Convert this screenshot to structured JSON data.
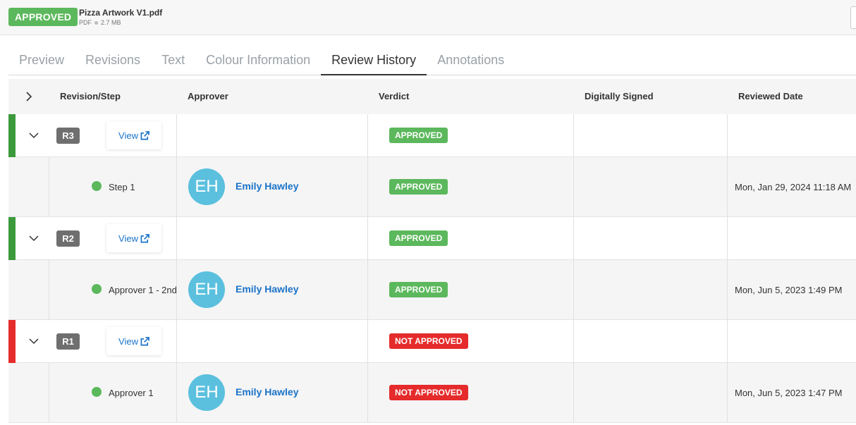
{
  "header": {
    "status": "APPROVED",
    "file_name": "Pizza Artwork V1.pdf",
    "file_type": "PDF",
    "file_size": "2.7 MB"
  },
  "tabs": [
    {
      "label": "Preview"
    },
    {
      "label": "Revisions"
    },
    {
      "label": "Text"
    },
    {
      "label": "Colour Information"
    },
    {
      "label": "Review History"
    },
    {
      "label": "Annotations"
    }
  ],
  "table": {
    "columns": {
      "revision_step": "Revision/Step",
      "approver": "Approver",
      "verdict": "Verdict",
      "digitally_signed": "Digitally Signed",
      "reviewed_date": "Reviewed Date"
    },
    "view_label": "View",
    "revisions": [
      {
        "badge": "R3",
        "verdict": "APPROVED",
        "accent_color": "#3c9a3c",
        "step": {
          "label": "Step 1",
          "avatar": "EH",
          "name": "Emily Hawley",
          "verdict": "APPROVED",
          "date": "Mon, Jan 29, 2024 11:18 AM"
        }
      },
      {
        "badge": "R2",
        "verdict": "APPROVED",
        "accent_color": "#3c9a3c",
        "step": {
          "label": "Approver 1 - 2nd",
          "avatar": "EH",
          "name": "Emily Hawley",
          "verdict": "APPROVED",
          "date": "Mon, Jun 5, 2023 1:49 PM"
        }
      },
      {
        "badge": "R1",
        "verdict": "NOT APPROVED",
        "accent_color": "#e52b2b",
        "step": {
          "label": "Approver 1",
          "avatar": "EH",
          "name": "Emily Hawley",
          "verdict": "NOT APPROVED",
          "date": "Mon, Jun 5, 2023 1:47 PM"
        }
      }
    ]
  }
}
